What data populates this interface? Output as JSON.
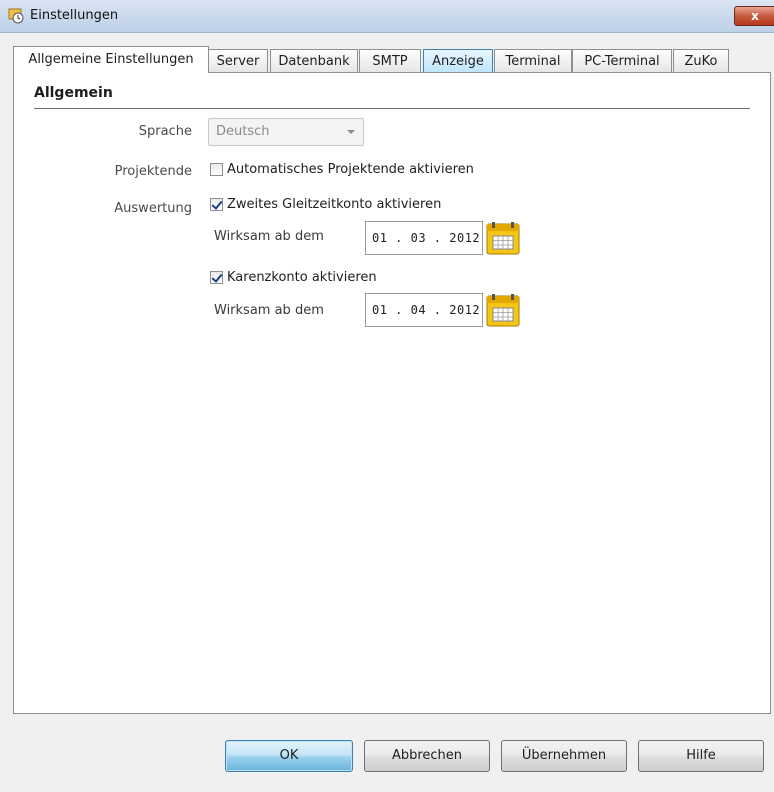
{
  "window": {
    "title": "Einstellungen",
    "close_symbol": "x"
  },
  "tabs": [
    {
      "label": "Allgemeine Einstellungen",
      "active": true
    },
    {
      "label": "Server"
    },
    {
      "label": "Datenbank"
    },
    {
      "label": "SMTP"
    },
    {
      "label": "Anzeige",
      "hover": true
    },
    {
      "label": "Terminal"
    },
    {
      "label": "PC-Terminal"
    },
    {
      "label": "ZuKo"
    }
  ],
  "section": {
    "title": "Allgemein"
  },
  "form": {
    "language": {
      "label": "Sprache",
      "value": "Deutsch"
    },
    "project_end": {
      "label": "Projektende",
      "checkbox_label": "Automatisches Projektende aktivieren",
      "checked": false
    },
    "evaluation": {
      "label": "Auswertung",
      "second_account": {
        "checkbox_label": "Zweites Gleitzeitkonto aktivieren",
        "checked": true,
        "effective_label": "Wirksam ab dem",
        "date": "01 . 03 . 2012"
      },
      "waiting_account": {
        "checkbox_label": "Karenzkonto aktivieren",
        "checked": true,
        "effective_label": "Wirksam ab dem",
        "date": "01 . 04 . 2012"
      }
    }
  },
  "buttons": {
    "ok": "OK",
    "cancel": "Abbrechen",
    "apply": "Übernehmen",
    "help": "Hilfe"
  },
  "colors": {
    "accent": "#3c7fb1",
    "calendar": "#f5c518"
  },
  "icons": [
    "app-clock-icon",
    "close-icon",
    "dropdown-arrow-icon",
    "calendar-icon"
  ]
}
